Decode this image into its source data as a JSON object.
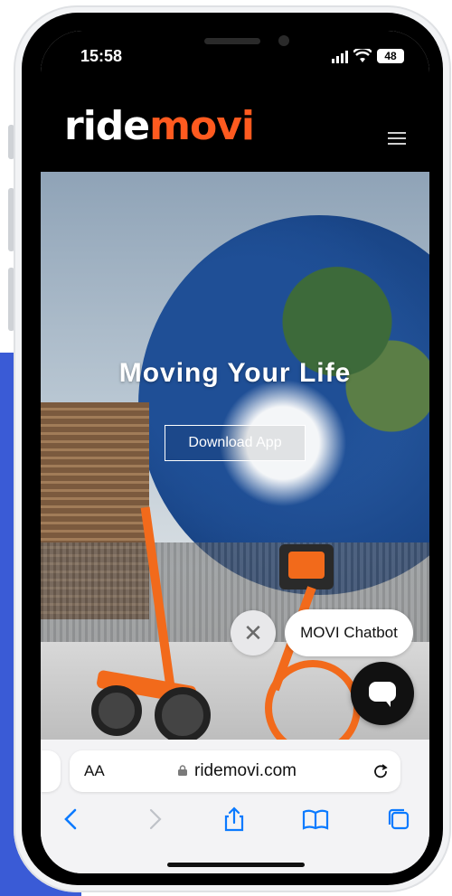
{
  "status_bar": {
    "time": "15:58",
    "battery": "48"
  },
  "site": {
    "logo_part1": "ride",
    "logo_part2": "movi",
    "hero_title": "Moving Your Life",
    "download_label": "Download App"
  },
  "chatbot": {
    "label": "MOVI Chatbot",
    "close_glyph": "✕"
  },
  "browser": {
    "aa_label": "AA",
    "url": "ridemovi.com"
  },
  "colors": {
    "brand_orange": "#ff5a1f",
    "ios_blue": "#0a7aff",
    "side_blue": "#3a5bd6"
  },
  "icons": [
    "signal-icon",
    "wifi-icon",
    "battery-icon",
    "menu-icon",
    "close-icon",
    "chat-icon",
    "lock-icon",
    "reload-icon",
    "back-icon",
    "forward-icon",
    "share-icon",
    "bookmarks-icon",
    "tabs-icon"
  ]
}
